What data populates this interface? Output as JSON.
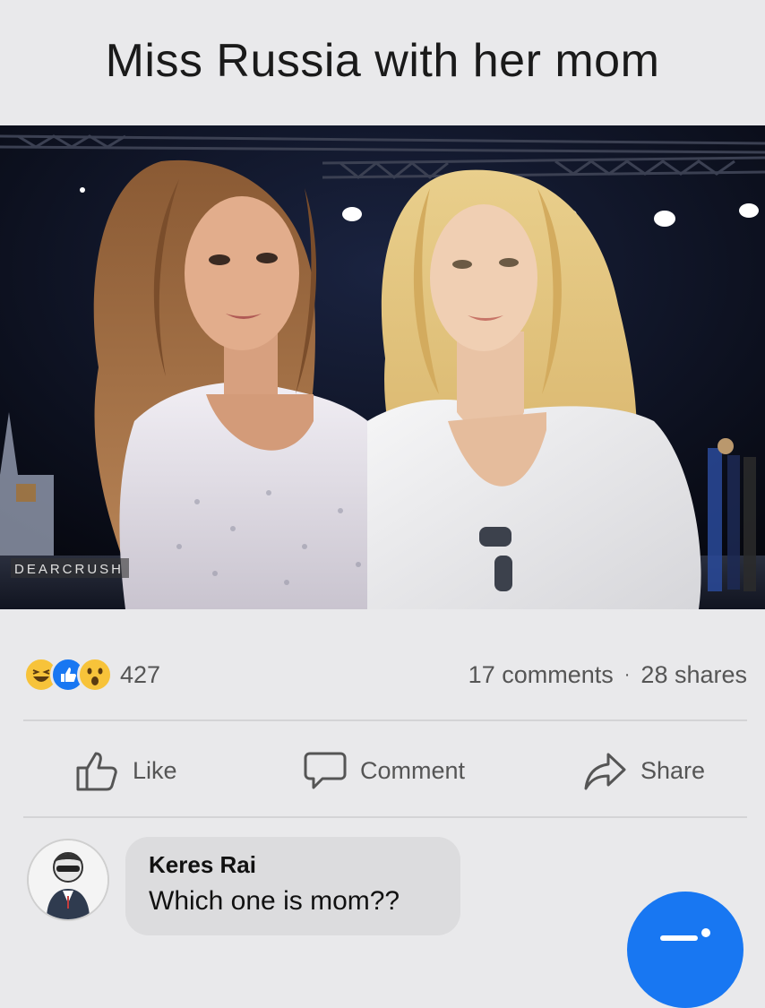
{
  "post": {
    "caption": "Miss Russia with her mom",
    "watermark": "DEARCRUSH"
  },
  "stats": {
    "reactions": [
      "haha-reaction-icon",
      "like-reaction-icon",
      "wow-reaction-icon"
    ],
    "reaction_count": "427",
    "comments": "17 comments",
    "separator": "·",
    "shares": "28 shares"
  },
  "actions": {
    "like_label": "Like",
    "comment_label": "Comment",
    "share_label": "Share"
  },
  "comment": {
    "author": "Keres Rai",
    "text": "Which one is mom??"
  },
  "colors": {
    "accent": "#1877f2",
    "background": "#e9e9eb",
    "secondary_text": "#555555"
  }
}
